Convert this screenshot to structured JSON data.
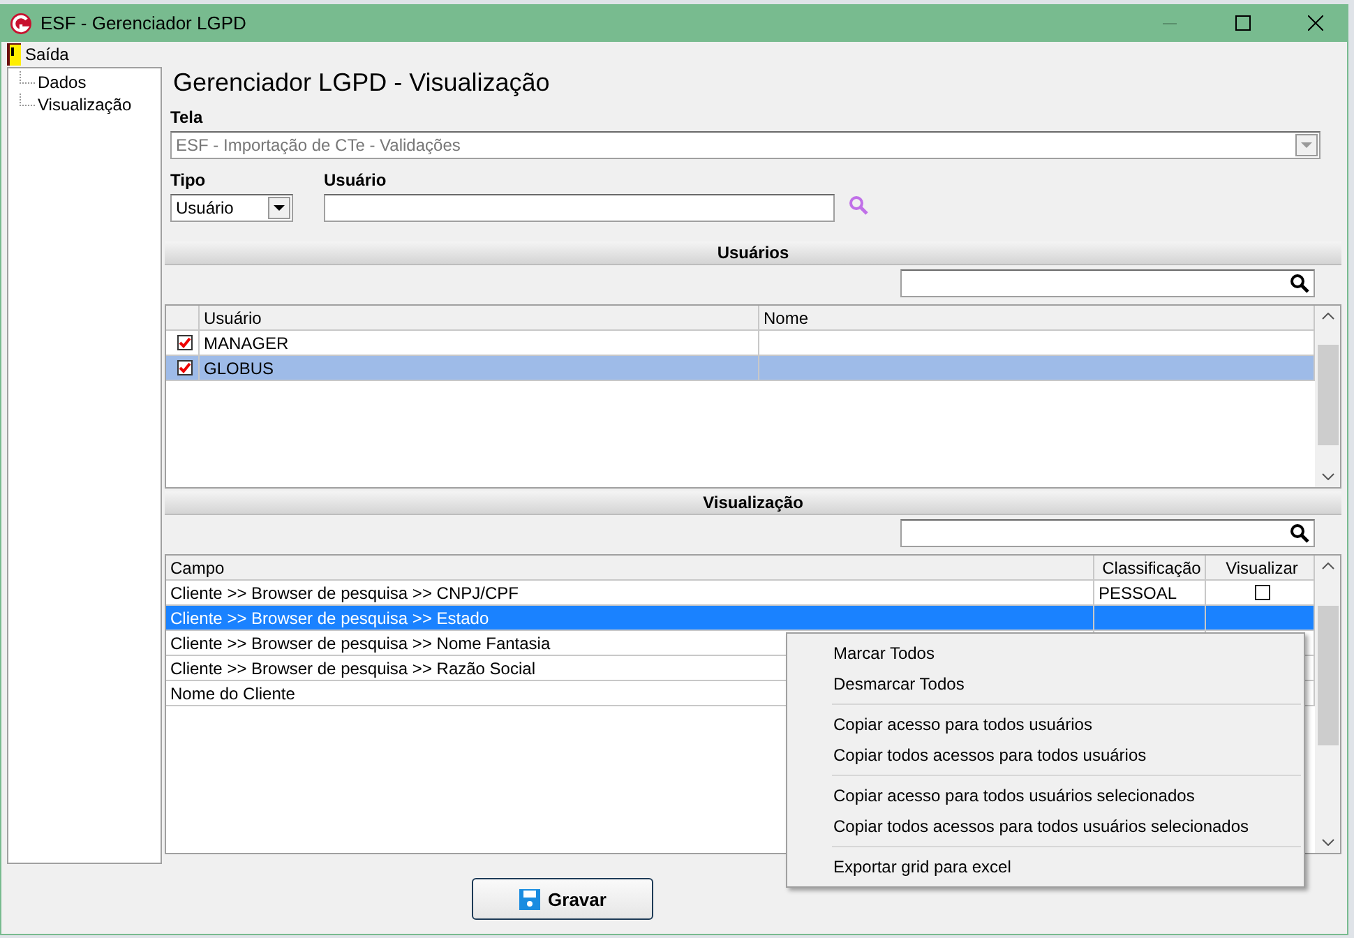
{
  "window": {
    "title": "ESF - Gerenciador LGPD"
  },
  "menu": [
    {
      "label": "Saída"
    }
  ],
  "tree": [
    {
      "label": "Dados",
      "selected": false
    },
    {
      "label": "Visualização",
      "selected": false
    }
  ],
  "heading": "Gerenciador LGPD - Visualização",
  "tela": {
    "label": "Tela",
    "value": "ESF - Importação de CTe - Validações",
    "disabled": true
  },
  "tipo": {
    "label": "Tipo",
    "value": "Usuário"
  },
  "usuario": {
    "label": "Usuário"
  },
  "usuarios": {
    "title": "Usuários",
    "columns": [
      "Usuário",
      "Nome"
    ],
    "rows": [
      {
        "usuario": "MANAGER",
        "nome": "",
        "checked": true,
        "selected": false
      },
      {
        "usuario": "GLOBUS",
        "nome": "",
        "checked": true,
        "selected": true
      }
    ]
  },
  "visualizacao": {
    "title": "Visualização",
    "columns": [
      "Campo",
      "Classificação",
      "Visualizar"
    ],
    "rows": [
      {
        "campo": "Cliente >> Browser de pesquisa >> CNPJ/CPF",
        "classificacao": "PESSOAL",
        "visualizar": false,
        "selected": false
      },
      {
        "campo": "Cliente >> Browser de pesquisa >> Estado",
        "selected": true
      },
      {
        "campo": "Cliente >> Browser de pesquisa >> Nome Fantasia",
        "selected": false
      },
      {
        "campo": "Cliente >> Browser de pesquisa >> Razão Social",
        "selected": false
      },
      {
        "campo": "Nome do Cliente",
        "selected": false
      }
    ]
  },
  "context_menu": [
    [
      "Marcar Todos",
      "Desmarcar Todos"
    ],
    [
      "Copiar acesso para todos usuários",
      "Copiar todos acessos para todos usuários"
    ],
    [
      "Copiar acesso para todos usuários selecionados",
      "Copiar todos acessos para todos usuários selecionados"
    ],
    [
      "Exportar grid para excel"
    ]
  ],
  "save_button": {
    "label": "Gravar"
  }
}
